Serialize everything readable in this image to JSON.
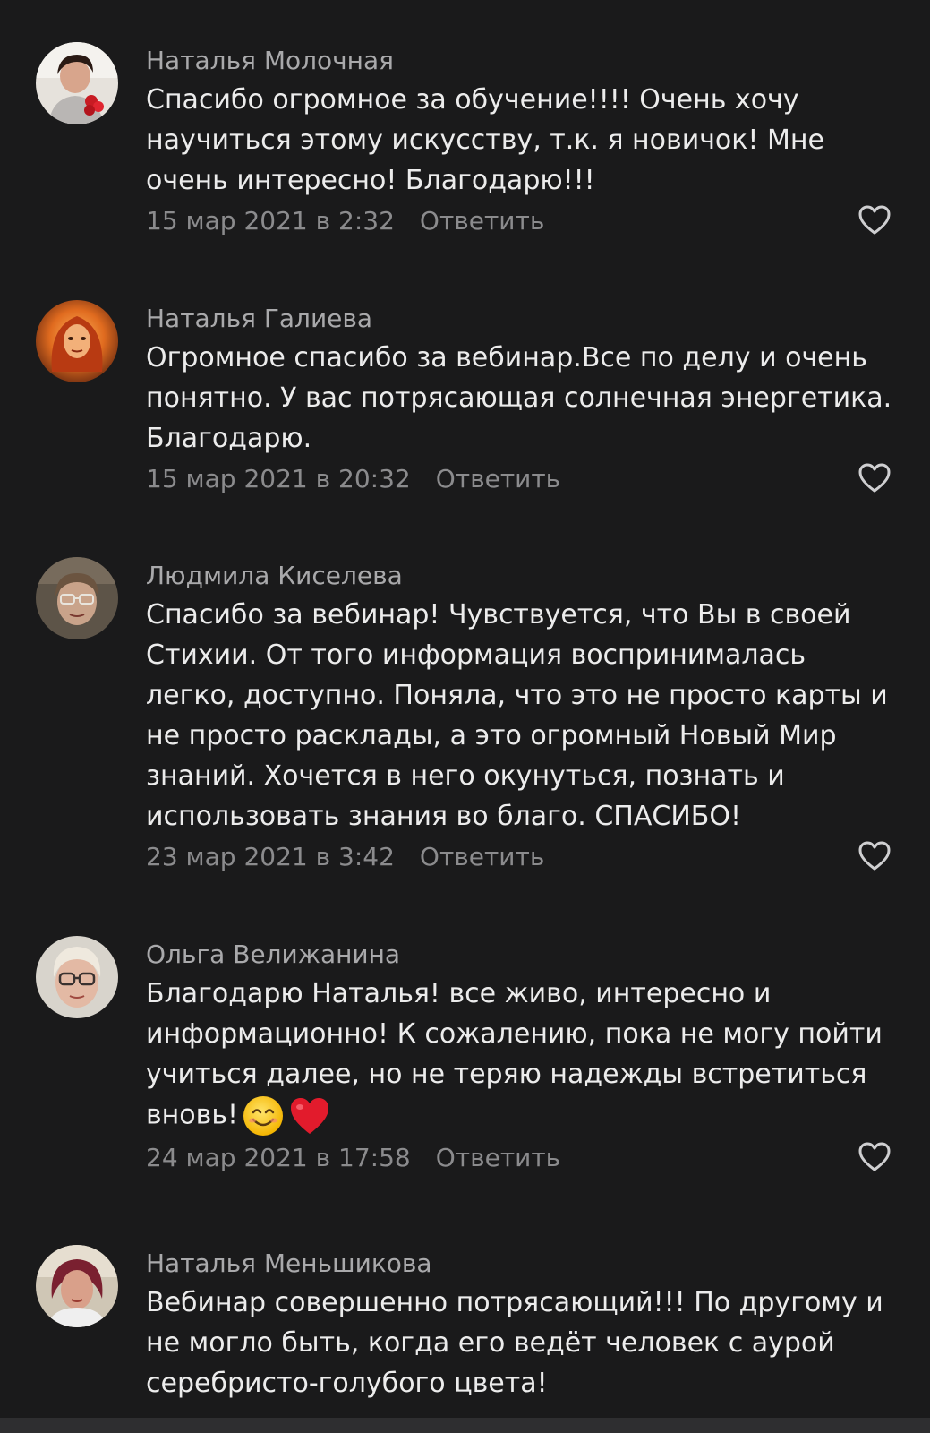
{
  "comments": [
    {
      "author": "Наталья Молочная",
      "text": "Спасибо огромное за обучение!!!! Очень хочу научиться этому искусству, т.к. я новичок! Мне очень интересно! Благодарю!!!",
      "date": "15 мар 2021 в 2:32",
      "reply_label": "Ответить"
    },
    {
      "author": "Наталья Галиева",
      "text": "Огромное спасибо за вебинар.Все по делу и очень понятно. У вас потрясающая солнечная энергетика. Благодарю.",
      "date": "15 мар 2021 в 20:32",
      "reply_label": "Ответить"
    },
    {
      "author": "Людмила Киселева",
      "text": "Спасибо за вебинар! Чувствуется, что Вы в своей Стихии. От того информация воспринималась легко, доступно. Поняла, что это не просто карты и не просто расклады, а это огромный Новый Мир знаний. Хочется в него окунуться, познать и использовать знания во благо. СПАСИБО!",
      "date": "23 мар 2021 в 3:42",
      "reply_label": "Ответить"
    },
    {
      "author": "Ольга Велижанина",
      "text": "Благодарю Наталья! все живо, интересно и информационно! К сожалению, пока не могу пойти учиться далее, но не теряю надежды встретиться вновь!",
      "date": "24 мар 2021 в 17:58",
      "reply_label": "Ответить",
      "emojis": [
        "smiling-face-emoji",
        "red-heart-emoji"
      ]
    },
    {
      "author": "Наталья Меньшикова",
      "text": "Вебинар совершенно потрясающий!!! По другому и не могло быть, когда его ведёт человек с аурой серебристо-голубого цвета!"
    }
  ],
  "icons": {
    "like": "heart-outline-icon"
  },
  "colors": {
    "background": "#1a1a1b",
    "text": "#ececec",
    "author": "#a9a9ab",
    "meta": "#8b8b8d"
  }
}
